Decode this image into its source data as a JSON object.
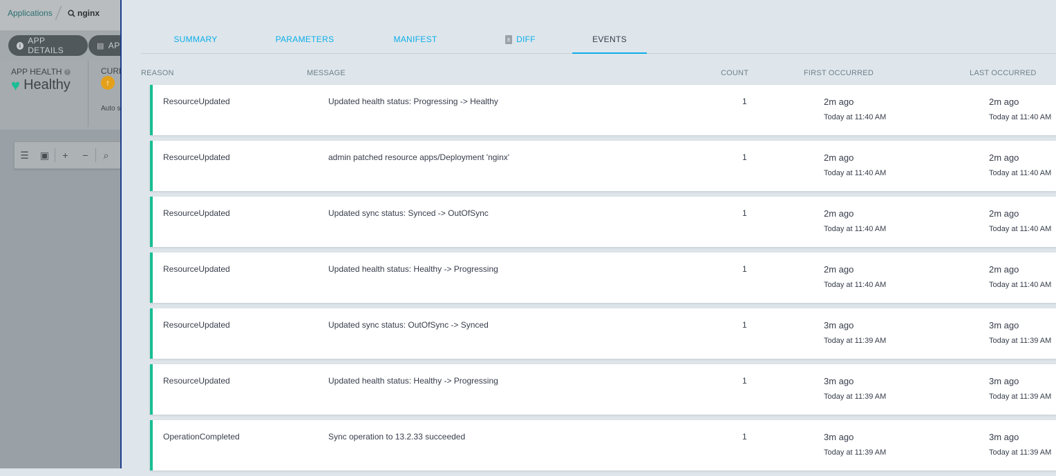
{
  "breadcrumb": {
    "applications": "Applications",
    "app_name": "nginx"
  },
  "toolbar": {
    "app_details": "APP DETAILS",
    "app_diff_partial": "APP"
  },
  "status": {
    "app_health_label": "APP HEALTH",
    "app_health_value": "Healthy",
    "current_sync_label_partial": "CURR",
    "auto_sync_partial": "Auto s"
  },
  "graph_toolbar": {
    "icons": [
      "list-view-icon",
      "image-view-icon",
      "zoom-in-icon",
      "zoom-out-icon",
      "zoom-fit-icon"
    ]
  },
  "tabs": [
    {
      "label": "SUMMARY",
      "active": false
    },
    {
      "label": "PARAMETERS",
      "active": false
    },
    {
      "label": "MANIFEST",
      "active": false
    },
    {
      "label": "DIFF",
      "active": false
    },
    {
      "label": "EVENTS",
      "active": true
    }
  ],
  "table": {
    "headers": {
      "reason": "REASON",
      "message": "MESSAGE",
      "count": "COUNT",
      "first": "FIRST OCCURRED",
      "last": "LAST OCCURRED"
    },
    "rows": [
      {
        "reason": "ResourceUpdated",
        "message": "Updated health status: Progressing -> Healthy",
        "count": "1",
        "first_rel": "2m ago",
        "first_abs": "Today at 11:40 AM",
        "last_rel": "2m ago",
        "last_abs": "Today at 11:40 AM"
      },
      {
        "reason": "ResourceUpdated",
        "message": "admin patched resource apps/Deployment 'nginx'",
        "count": "1",
        "first_rel": "2m ago",
        "first_abs": "Today at 11:40 AM",
        "last_rel": "2m ago",
        "last_abs": "Today at 11:40 AM"
      },
      {
        "reason": "ResourceUpdated",
        "message": "Updated sync status: Synced -> OutOfSync",
        "count": "1",
        "first_rel": "2m ago",
        "first_abs": "Today at 11:40 AM",
        "last_rel": "2m ago",
        "last_abs": "Today at 11:40 AM"
      },
      {
        "reason": "ResourceUpdated",
        "message": "Updated health status: Healthy -> Progressing",
        "count": "1",
        "first_rel": "2m ago",
        "first_abs": "Today at 11:40 AM",
        "last_rel": "2m ago",
        "last_abs": "Today at 11:40 AM"
      },
      {
        "reason": "ResourceUpdated",
        "message": "Updated sync status: OutOfSync -> Synced",
        "count": "1",
        "first_rel": "3m ago",
        "first_abs": "Today at 11:39 AM",
        "last_rel": "3m ago",
        "last_abs": "Today at 11:39 AM"
      },
      {
        "reason": "ResourceUpdated",
        "message": "Updated health status: Healthy -> Progressing",
        "count": "1",
        "first_rel": "3m ago",
        "first_abs": "Today at 11:39 AM",
        "last_rel": "3m ago",
        "last_abs": "Today at 11:39 AM"
      },
      {
        "reason": "OperationCompleted",
        "message": "Sync operation to 13.2.33 succeeded",
        "count": "1",
        "first_rel": "3m ago",
        "first_abs": "Today at 11:39 AM",
        "last_rel": "3m ago",
        "last_abs": "Today at 11:39 AM"
      }
    ]
  },
  "colors": {
    "accent": "#0dadea",
    "healthy": "#18be94",
    "sync_warning": "#e4a01b",
    "panel_bg": "#dee6eb"
  }
}
